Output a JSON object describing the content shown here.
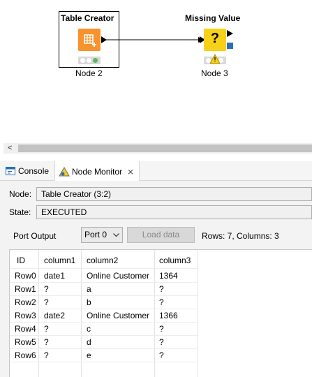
{
  "workflow": {
    "node2": {
      "title": "Table Creator",
      "label": "Node 2",
      "icon": "table-creator-icon",
      "color": "#f7922d",
      "status": "executed"
    },
    "node3": {
      "title": "Missing Value",
      "label": "Node 3",
      "icon": "missing-value-icon",
      "symbol": "?",
      "color": "#f7d117",
      "status": "warning",
      "warning_symbol": "!"
    }
  },
  "scrollbar": {
    "left_arrow": "<"
  },
  "tabs": [
    {
      "label": "Console",
      "icon": "console-icon",
      "active": false
    },
    {
      "label": "Node Monitor",
      "icon": "node-monitor-icon",
      "active": true,
      "close": "⨯"
    }
  ],
  "monitor": {
    "node_label": "Node:",
    "node_value": "Table Creator  (3:2)",
    "state_label": "State:",
    "state_value": "EXECUTED",
    "port_output_label": "Port Output",
    "port_selected": "Port 0",
    "load_button": "Load data",
    "rows_info": "Rows: 7, Columns: 3"
  },
  "table": {
    "headers": [
      "ID",
      "column1",
      "column2",
      "column3"
    ],
    "rows": [
      [
        "Row0",
        "date1",
        "Online Customer",
        "1364"
      ],
      [
        "Row1",
        "?",
        "a",
        "?"
      ],
      [
        "Row2",
        "?",
        "b",
        "?"
      ],
      [
        "Row3",
        "date2",
        "Online Customer",
        "1366"
      ],
      [
        "Row4",
        "?",
        "c",
        "?"
      ],
      [
        "Row5",
        "?",
        "d",
        "?"
      ],
      [
        "Row6",
        "?",
        "e",
        "?"
      ]
    ]
  },
  "colors": {
    "accent_blue": "#2a6fb6",
    "status_green": "#5bb75b",
    "warning_yellow": "#f7d117",
    "node_orange": "#f7922d"
  }
}
